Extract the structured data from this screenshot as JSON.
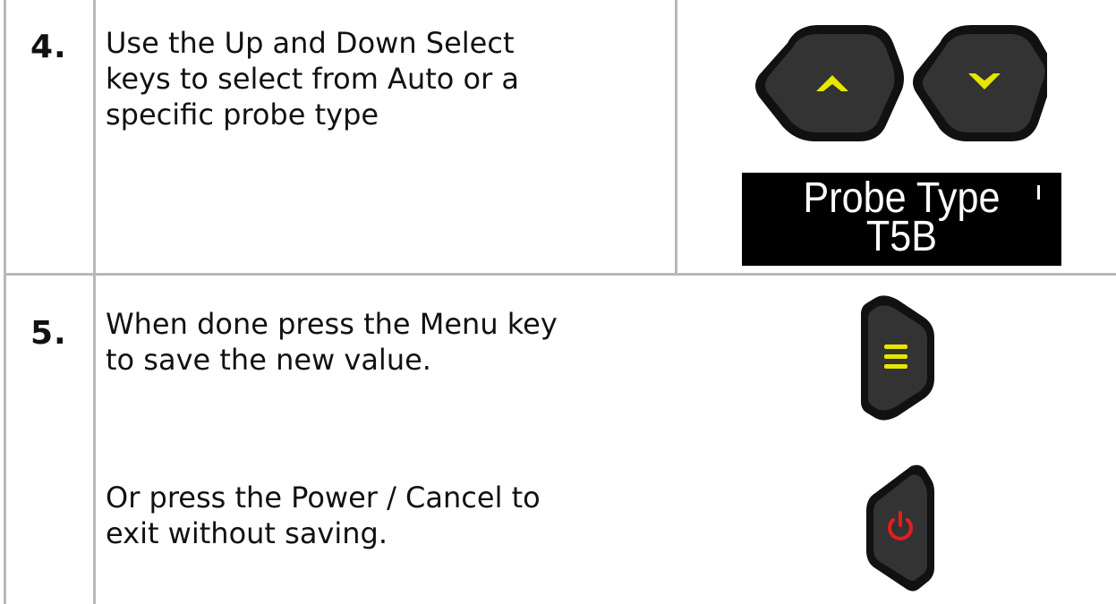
{
  "steps": [
    {
      "number": "4.",
      "text_lines": [
        "Use the Up and Down Select",
        "keys to select from Auto or a",
        "specific probe type"
      ],
      "keys": [
        "up-arrow-key",
        "down-arrow-key"
      ],
      "display": {
        "line1": "Probe Type",
        "line2": "T5B"
      }
    },
    {
      "number": "5.",
      "text_lines": [
        "When done press the Menu key",
        "to save the new value."
      ],
      "text_lines_2": [
        "Or press the Power / Cancel to",
        "exit without saving."
      ],
      "keys": [
        "menu-key",
        "power-cancel-key"
      ]
    }
  ],
  "colors": {
    "key_body": "#1f1f1f",
    "key_face": "#333333",
    "accent_yellow": "#e6e600",
    "power_red": "#e41e1e",
    "grid_line": "#b8b8b8"
  }
}
